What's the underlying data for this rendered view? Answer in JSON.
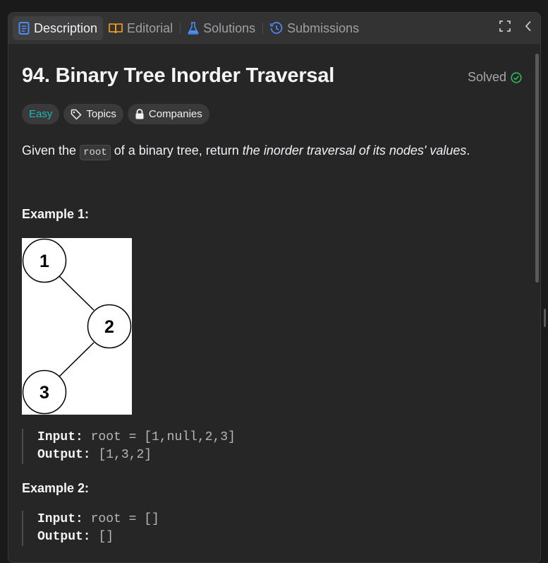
{
  "tabs": [
    {
      "label": "Description",
      "icon": "description-icon",
      "color": "#4c8bf5"
    },
    {
      "label": "Editorial",
      "icon": "book-icon",
      "color": "#ffa116"
    },
    {
      "label": "Solutions",
      "icon": "flask-icon",
      "color": "#4c8bf5"
    },
    {
      "label": "Submissions",
      "icon": "history-icon",
      "color": "#4c8bf5"
    }
  ],
  "problem": {
    "title": "94. Binary Tree Inorder Traversal",
    "status": "Solved",
    "difficulty": "Easy",
    "topics_label": "Topics",
    "companies_label": "Companies",
    "desc_prefix": "Given the",
    "desc_code": "root",
    "desc_middle": "of a binary tree, return",
    "desc_italic": "the inorder traversal of its nodes' values",
    "desc_suffix": "."
  },
  "examples": [
    {
      "title": "Example 1:",
      "tree_nodes": [
        "1",
        "2",
        "3"
      ],
      "input_label": "Input:",
      "input_value": "root = [1,null,2,3]",
      "output_label": "Output:",
      "output_value": "[1,3,2]"
    },
    {
      "title": "Example 2:",
      "input_label": "Input:",
      "input_value": "root = []",
      "output_label": "Output:",
      "output_value": "[]"
    }
  ],
  "colors": {
    "accent_easy": "#1cb8b8",
    "solved_check": "#2cbb5d"
  }
}
